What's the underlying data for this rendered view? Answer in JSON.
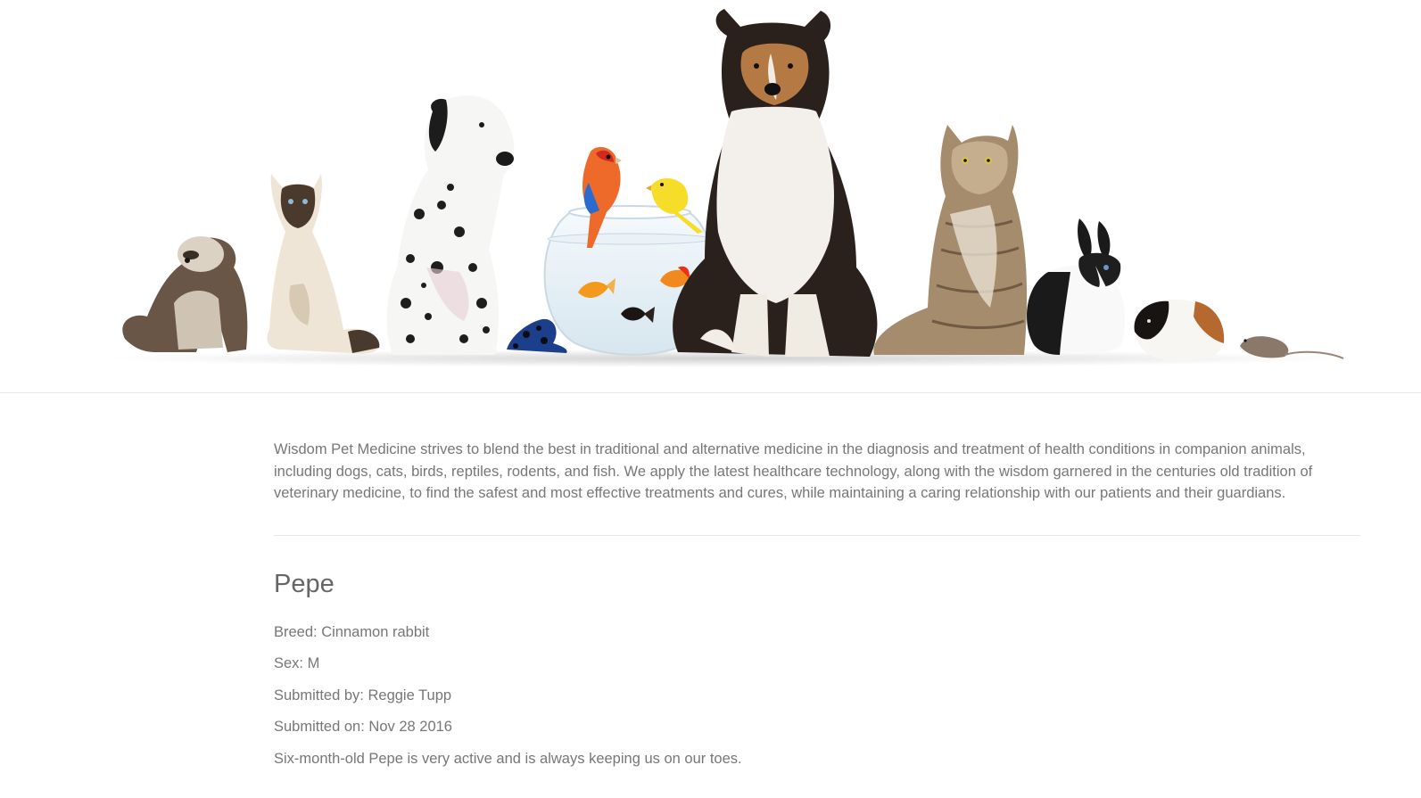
{
  "hero": {
    "animals": [
      "ferret",
      "siamese-cat",
      "dalmatian-puppy",
      "poison-dart-frog",
      "fishbowl",
      "rosella-parrot",
      "canary",
      "goldfish",
      "sheltie-dog",
      "tabby-cat",
      "dutch-rabbit",
      "guinea-pig",
      "mouse"
    ]
  },
  "intro": {
    "text": "Wisdom Pet Medicine strives to blend the best in traditional and alternative medicine in the diagnosis and treatment of health conditions in companion animals, including dogs, cats, birds, reptiles, rodents, and fish. We apply the latest healthcare technology, along with the wisdom garnered in the centuries old tradition of veterinary medicine, to find the safest and most effective treatments and cures, while maintaining a caring relationship with our patients and their guardians."
  },
  "pet": {
    "name": "Pepe",
    "breed_label": "Breed: ",
    "breed": "Cinnamon rabbit",
    "sex_label": "Sex: ",
    "sex": "M",
    "submitted_by_label": "Submitted by: ",
    "submitted_by": "Reggie Tupp",
    "submitted_on_label": "Submitted on: ",
    "submitted_on": "Nov 28 2016",
    "description": "Six-month-old Pepe is very active and is always keeping us on our toes."
  }
}
